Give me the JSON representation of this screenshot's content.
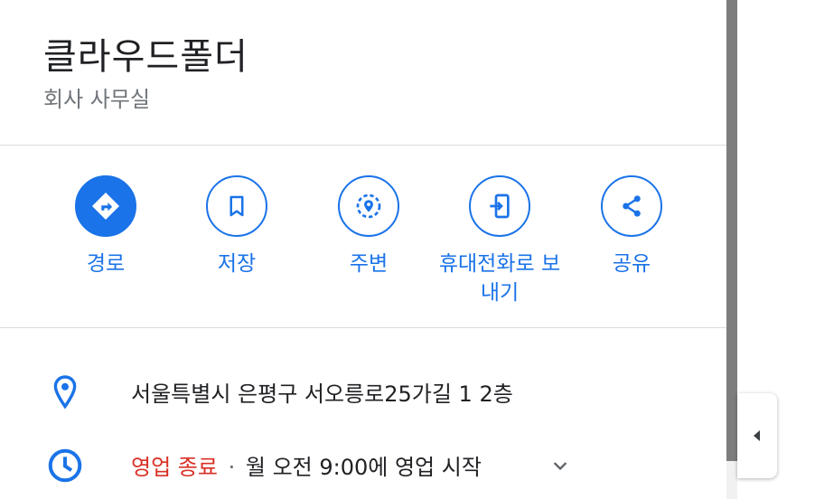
{
  "place": {
    "title": "클라우드폴더",
    "subtitle": "회사 사무실"
  },
  "actions": [
    {
      "label": "경로",
      "icon": "directions-icon"
    },
    {
      "label": "저장",
      "icon": "bookmark-icon"
    },
    {
      "label": "주변",
      "icon": "nearby-icon"
    },
    {
      "label": "휴대전화로 보내기",
      "icon": "send-to-phone-icon"
    },
    {
      "label": "공유",
      "icon": "share-icon"
    }
  ],
  "info": {
    "address": "서울특별시 은평구 서오릉로25가길 1 2층",
    "hours_status": "영업 종료",
    "hours_separator": "·",
    "hours_detail": "월 오전 9:00에 영업 시작"
  },
  "colors": {
    "accent": "#1a73e8",
    "closed": "#d93025"
  }
}
